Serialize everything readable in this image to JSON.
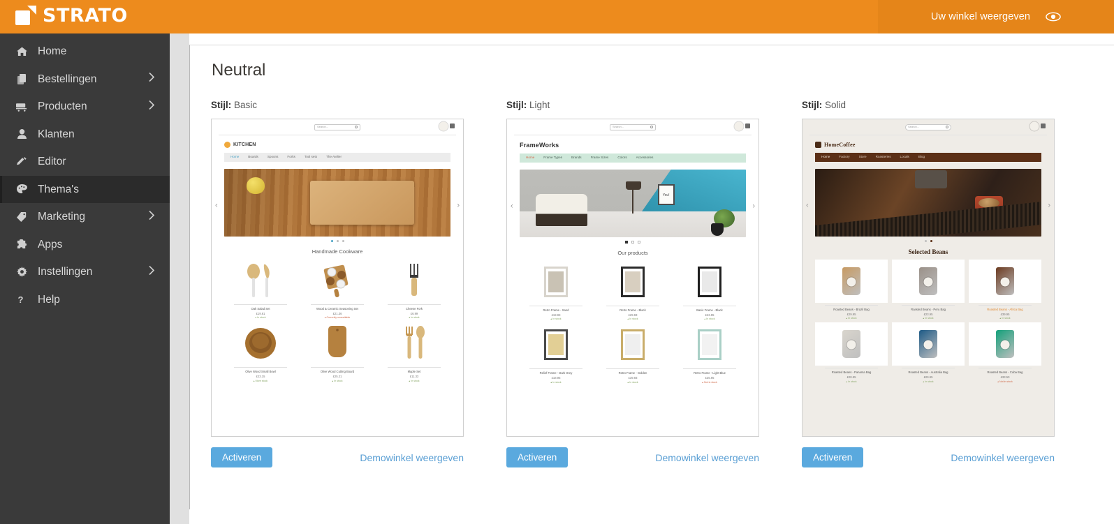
{
  "topbar": {
    "brand": "STRATO",
    "view_shop_label": "Uw winkel weergeven",
    "eye_icon": "eye-icon",
    "bg_color": "#ed8b1d",
    "panel_color": "#e58519"
  },
  "sidebar": {
    "items": [
      {
        "label": "Home",
        "icon": "home-icon",
        "chevron": "",
        "active": false
      },
      {
        "label": "Bestellingen",
        "icon": "orders-icon",
        "chevron": "›",
        "active": false
      },
      {
        "label": "Producten",
        "icon": "cart-icon",
        "chevron": "›",
        "active": false
      },
      {
        "label": "Klanten",
        "icon": "user-icon",
        "chevron": "",
        "active": false
      },
      {
        "label": "Editor",
        "icon": "pencil-icon",
        "chevron": "",
        "active": false
      },
      {
        "label": "Thema's",
        "icon": "palette-icon",
        "chevron": "",
        "active": true
      },
      {
        "label": "Marketing",
        "icon": "tag-icon",
        "chevron": "›",
        "active": false
      },
      {
        "label": "Apps",
        "icon": "puzzle-icon",
        "chevron": "",
        "active": false
      },
      {
        "label": "Instellingen",
        "icon": "gear-icon",
        "chevron": "›",
        "active": false
      },
      {
        "label": "Help",
        "icon": "question-icon",
        "chevron": "",
        "active": false
      }
    ]
  },
  "page": {
    "title": "Neutral",
    "style_label": "Stijl:",
    "activate_label": "Activeren",
    "demo_label": "Demowinkel weergeven",
    "accent_button_color": "#5aa9de",
    "link_color": "#5a9fd4"
  },
  "themes": [
    {
      "style": "Basic",
      "shop": {
        "brand": "KITCHEN",
        "search_placeholder": "Search...",
        "nav": [
          "Home",
          "Boards",
          "Spoons",
          "Forks",
          "Tool sets",
          "The Atelier"
        ],
        "nav_current": "Home",
        "section_title": "Handmade Cookware",
        "slides": 3,
        "active_slide": 1,
        "products": [
          {
            "name": "Oak Salad Set",
            "price": "£19.61",
            "stock": "In stock"
          },
          {
            "name": "Wood & Ceramic Seasoning Set",
            "price": "£21.36",
            "stock": "Currently unavailable"
          },
          {
            "name": "Cheese Fork",
            "price": "£6.99",
            "stock": "In stock"
          },
          {
            "name": "Olive Wood Small Bowl",
            "price": "£23.15",
            "stock": "More stock"
          },
          {
            "name": "Olive Wood Cutting Board",
            "price": "£25.21",
            "stock": "In stock"
          },
          {
            "name": "Maple Set",
            "price": "£11.33",
            "stock": "In stock"
          }
        ]
      }
    },
    {
      "style": "Light",
      "shop": {
        "brand": "FrameWorks",
        "search_placeholder": "Search...",
        "nav": [
          "Home",
          "Frame Types",
          "Brands",
          "Frame Sizes",
          "Colors",
          "Accessories"
        ],
        "nav_current": "Home",
        "section_title": "Our products",
        "slides": 3,
        "active_slide": 1,
        "products": [
          {
            "name": "Retro Frame - Sand",
            "price": "£19.93",
            "stock": "In stock"
          },
          {
            "name": "Retro Frame - Black",
            "price": "£29.93",
            "stock": "In stock"
          },
          {
            "name": "Basic Frame - Black",
            "price": "£23.95",
            "stock": "In stock"
          },
          {
            "name": "Relief Frame - Dark Grey",
            "price": "£18.95",
            "stock": "In stock"
          },
          {
            "name": "Retro Frame - Golden",
            "price": "£39.93",
            "stock": "In stock"
          },
          {
            "name": "Retro Frame - Light Blue",
            "price": "£35.95",
            "stock": "Not in stock"
          }
        ]
      }
    },
    {
      "style": "Solid",
      "shop": {
        "brand": "HomeCoffee",
        "search_placeholder": "Search...",
        "nav": [
          "Home",
          "Factory",
          "Store",
          "Roasteries",
          "Locals",
          "Blog"
        ],
        "nav_current": "Home",
        "section_title": "Selected Beans",
        "slides": 2,
        "active_slide": 2,
        "products": [
          {
            "name": "Roasted Beans - Brazil Bag",
            "price": "£29.95",
            "stock": "In stock"
          },
          {
            "name": "Roasted Beans - Peru Bag",
            "price": "£23.95",
            "stock": "In stock"
          },
          {
            "name": "Roasted Beans - Africa Bag",
            "price": "£39.95",
            "stock": "In stock",
            "sale": true
          },
          {
            "name": "Roasted Beans - Panama Bag",
            "price": "£28.95",
            "stock": "In stock"
          },
          {
            "name": "Roasted Beans - Australia Bag",
            "price": "£29.95",
            "stock": "In stock"
          },
          {
            "name": "Roasted Beans - Cuba Bag",
            "price": "£33.50",
            "stock": "Not in stock"
          }
        ]
      }
    }
  ]
}
